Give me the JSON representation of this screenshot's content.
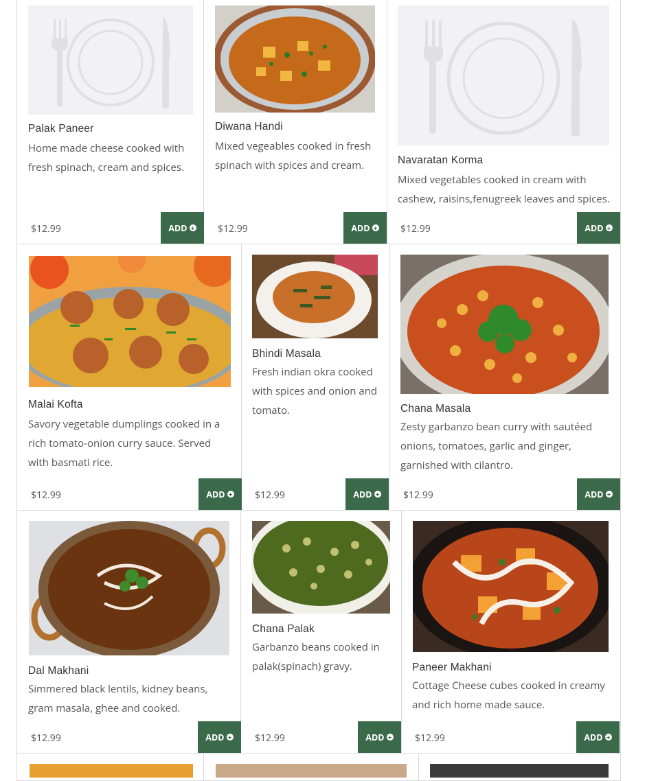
{
  "currency_price": "$12.99",
  "add_label": "ADD",
  "items": [
    {
      "name": "Palak Paneer",
      "desc": "Home made cheese cooked with fresh spinach, cream and spices.",
      "price": "$12.99",
      "image": "placeholder-plate"
    },
    {
      "name": "Diwana Handi",
      "desc": "Mixed vegeables cooked in fresh spinach with spices and cream.",
      "price": "$12.99",
      "image": "curry-copper-bowl"
    },
    {
      "name": "Navaratan Korma",
      "desc": "Mixed vegetables cooked in cream with cashew, raisins,fenugreek leaves and spices.",
      "price": "$12.99",
      "image": "placeholder-plate"
    },
    {
      "name": "Malai Kofta",
      "desc": "Savory vegetable dumplings cooked in a rich tomato-onion curry sauce. Served with basmati rice.",
      "price": "$12.99",
      "image": "kofta-dish"
    },
    {
      "name": "Bhindi Masala",
      "desc": "Fresh indian okra cooked with spices and onion and tomato.",
      "price": "$12.99",
      "image": "okra-bowl"
    },
    {
      "name": "Chana Masala",
      "desc": "Zesty garbanzo bean curry with sautéed onions, tomatoes, garlic and ginger, garnished with cilantro.",
      "price": "$12.99",
      "image": "chickpea-bowl"
    },
    {
      "name": "Dal Makhani",
      "desc": "Simmered black lentils, kidney beans, gram masala, ghee and cooked.",
      "price": "$12.99",
      "image": "dal-kadai"
    },
    {
      "name": "Chana Palak",
      "desc": "Garbanzo beans cooked in palak(spinach) gravy.",
      "price": "$12.99",
      "image": "spinach-chickpea-bowl"
    },
    {
      "name": "Paneer Makhani",
      "desc": "Cottage Cheese cubes cooked in creamy and rich home made sauce.",
      "price": "$12.99",
      "image": "paneer-makhani-bowl"
    }
  ],
  "colors": {
    "add_button": "#3b6a4a",
    "border": "#d9d9d9",
    "placeholder_bg": "#f2f2f4"
  }
}
